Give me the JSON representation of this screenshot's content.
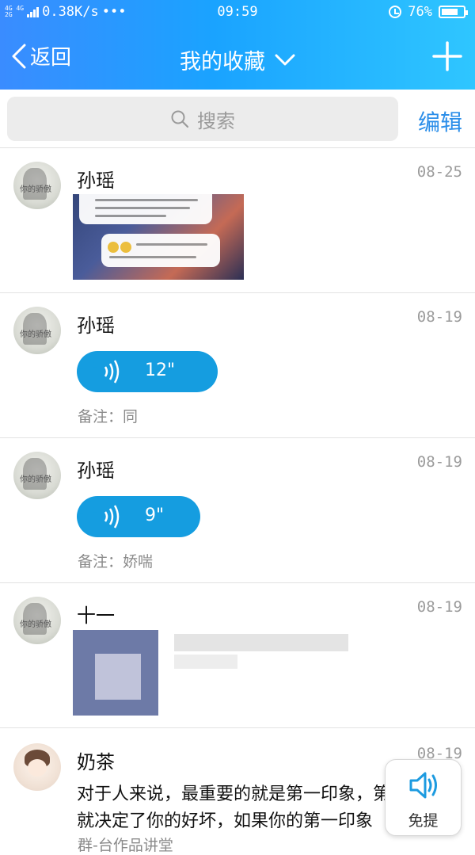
{
  "status_bar": {
    "network": "4G 4G",
    "network2": "2G",
    "speed": "0.38K/s",
    "more": "•••",
    "time": "09:59",
    "battery": "76%",
    "battery_level": 0.76
  },
  "nav": {
    "back_label": "返回",
    "title": "我的收藏"
  },
  "search": {
    "placeholder": "搜索",
    "edit_label": "编辑"
  },
  "items": [
    {
      "name": "孙瑶",
      "date": "08-25",
      "type": "image"
    },
    {
      "name": "孙瑶",
      "date": "08-19",
      "type": "voice",
      "duration": "12\"",
      "note": "备注：同"
    },
    {
      "name": "孙瑶",
      "date": "08-19",
      "type": "voice",
      "duration": "9\"",
      "note": "备注：娇喘"
    },
    {
      "name": "十一",
      "date": "08-19",
      "type": "link"
    },
    {
      "name": "奶茶",
      "date": "08-19",
      "type": "text",
      "line1": "对于人来说，最重要的就是第一印象，第",
      "line2": "就决定了你的好坏，如果你的第一印象",
      "line3": "群-台作品讲堂"
    }
  ],
  "float_button": {
    "label": "免提",
    "icon": "speaker-icon"
  },
  "colors": {
    "header_start": "#3a8cff",
    "header_end": "#2fc6ff",
    "accent": "#2b8ee9",
    "voice_bubble": "#159de0"
  }
}
